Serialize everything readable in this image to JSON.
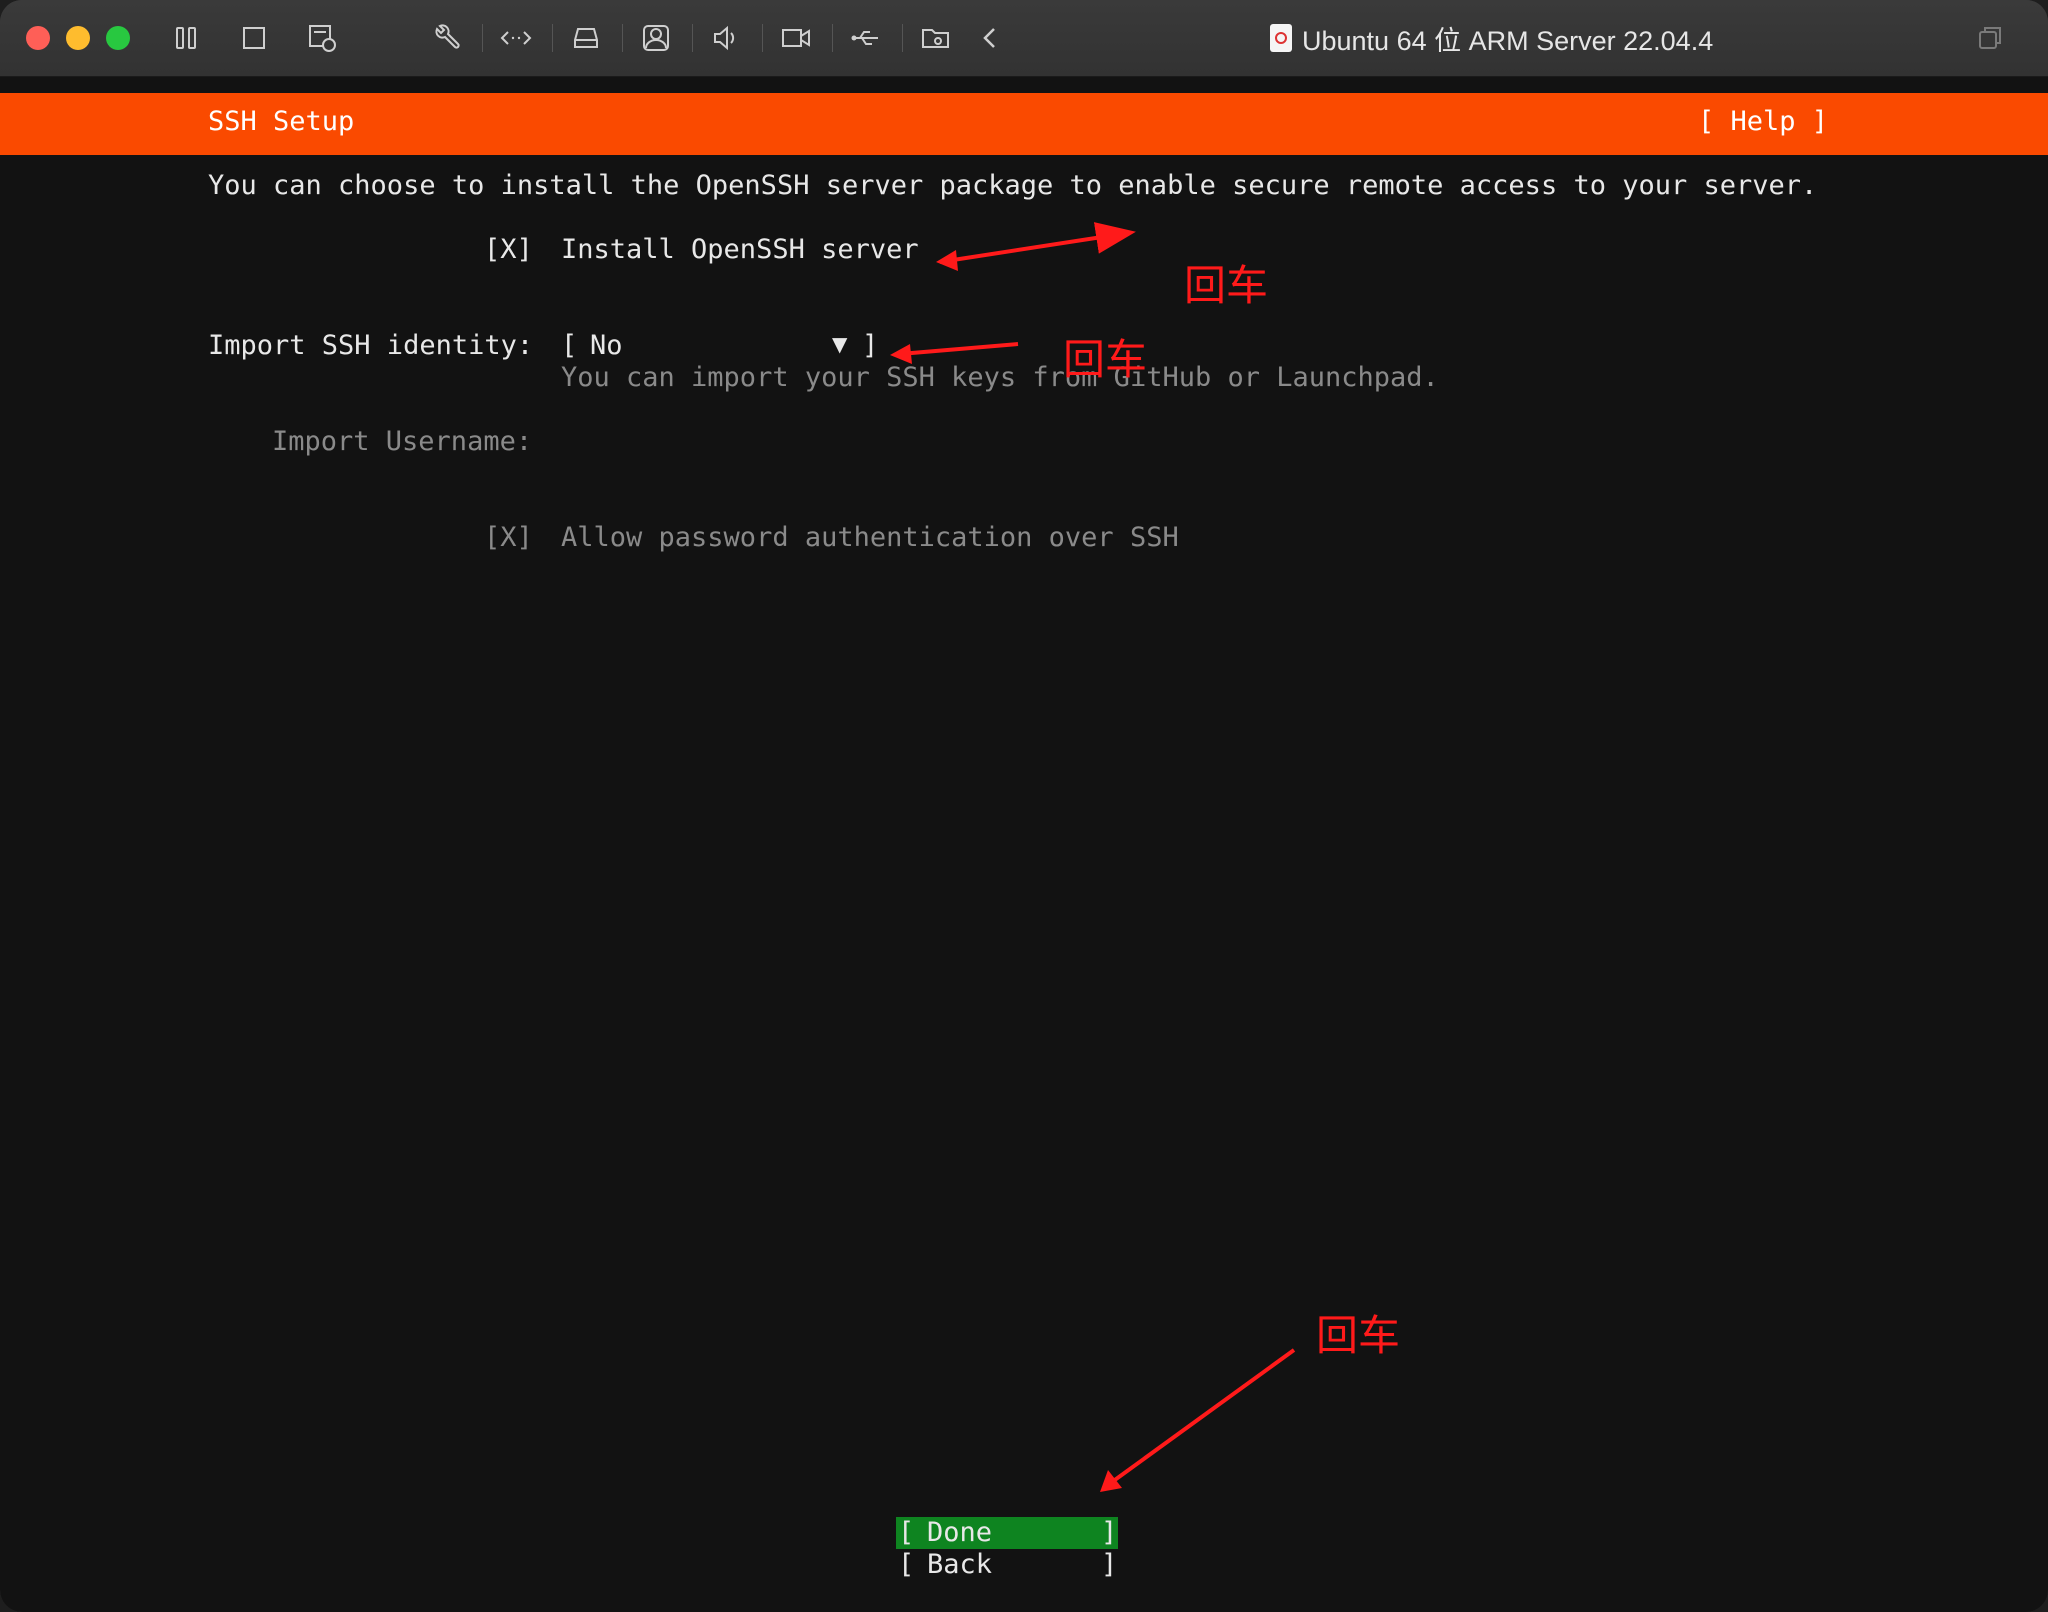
{
  "window": {
    "title": "Ubuntu 64 位 ARM Server 22.04.4",
    "toolbar_icons": [
      "pause-icon",
      "stop-icon",
      "snapshot-icon",
      "wrench-icon",
      "code-arrows-icon",
      "disk-icon",
      "user-icon",
      "speaker-icon",
      "camera-icon",
      "usb-icon",
      "shared-folder-icon",
      "chevron-left-icon"
    ]
  },
  "installer": {
    "header_title": "SSH Setup",
    "help_label": "[ Help ]",
    "description": "You can choose to install the OpenSSH server package to enable secure remote access to your server.",
    "install_openssh": {
      "checkbox": "[X]",
      "label": "Install OpenSSH server"
    },
    "import_identity": {
      "label": "Import SSH identity:",
      "open_bracket": "[",
      "value": "No",
      "arrow": "▼",
      "close_bracket": "]",
      "hint": "You can import your SSH keys from GitHub or Launchpad."
    },
    "import_username": {
      "label": "Import Username:"
    },
    "allow_password": {
      "checkbox": "[X]",
      "label": "Allow password authentication over SSH"
    },
    "done_button": {
      "open": "[",
      "label": "Done",
      "close": "]"
    },
    "back_button": {
      "open": "[",
      "label": "Back",
      "close": "]"
    }
  },
  "annotations": {
    "note_1": "回车",
    "note_2": "回车",
    "note_3": "回车",
    "color": "#ff1a1a"
  },
  "colors": {
    "header_orange": "#fa4a00",
    "done_green": "#0e8420",
    "terminal_bg": "#121212"
  }
}
